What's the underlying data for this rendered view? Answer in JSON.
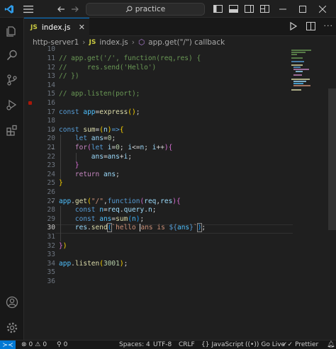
{
  "titlebar": {
    "search_text": "practice"
  },
  "tab": {
    "badge": "JS",
    "label": "index.js"
  },
  "breadcrumb": {
    "folder": "http-server1",
    "file_badge": "JS",
    "file": "index.js",
    "symbol": "app.get(\"/\") callback"
  },
  "line_numbers": [
    "10",
    "11",
    "12",
    "13",
    "14",
    "15",
    "16",
    "17",
    "18",
    "19",
    "20",
    "21",
    "22",
    "23",
    "24",
    "25",
    "26",
    "27",
    "28",
    "29",
    "30",
    "31",
    "32",
    "33",
    "34",
    "35",
    "36"
  ],
  "active_line": "30",
  "statusbar": {
    "errors": "0",
    "warnings": "0",
    "ports": "0",
    "spaces": "Spaces: 4",
    "encoding": "UTF-8",
    "eol": "CRLF",
    "language_braces": "{}",
    "language": "JavaScript",
    "golive": "Go Live",
    "prettier": "Prettier"
  },
  "colors": {
    "accent": "#0078d4",
    "editor_bg": "#1f1f1f",
    "breakpoint": "#e51400"
  }
}
